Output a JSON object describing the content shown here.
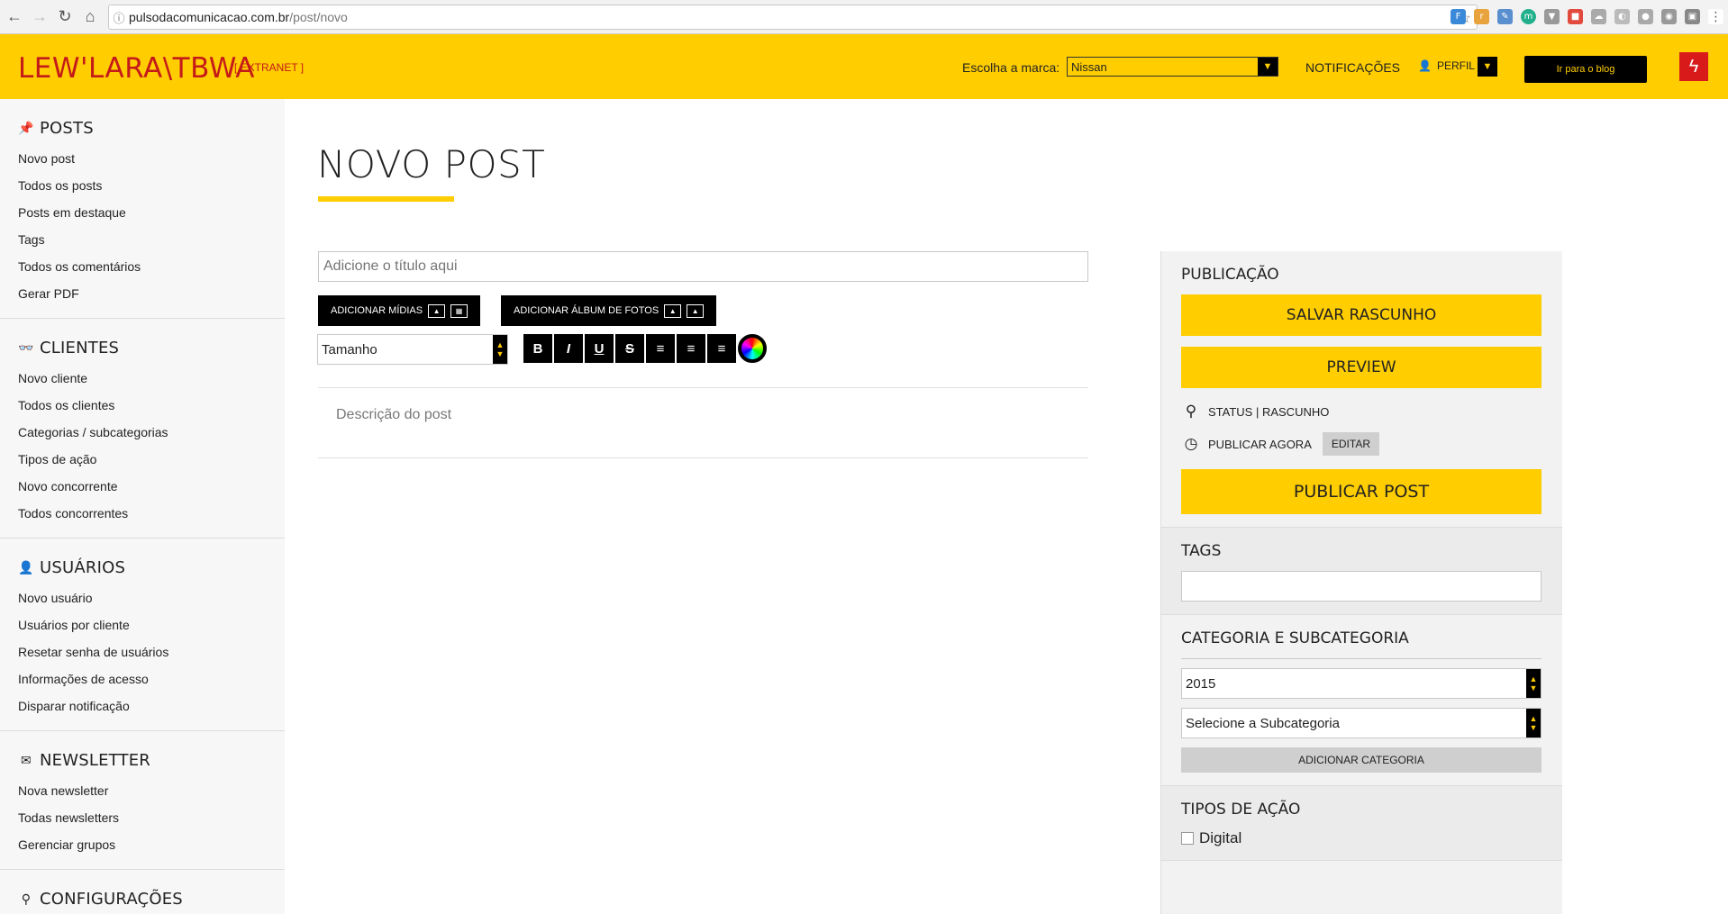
{
  "browser": {
    "url_host": "pulsodacomunicacao.com.br",
    "url_path": "/post/novo"
  },
  "header": {
    "logo": "LEW'LARA\\TBWA",
    "logo_sub": "[ EXTRANET ]",
    "brand_label": "Escolha a marca:",
    "brand_value": "Nissan",
    "notifications": "NOTIFICAÇÕES",
    "profile": "PERFIL",
    "blog_button": "Ir para o blog"
  },
  "sidebar": {
    "sections": [
      {
        "title": "POSTS",
        "icon": "pin-icon",
        "items": [
          "Novo post",
          "Todos os posts",
          "Posts em destaque",
          "Tags",
          "Todos os comentários",
          "Gerar PDF"
        ]
      },
      {
        "title": "CLIENTES",
        "icon": "glasses-icon",
        "items": [
          "Novo cliente",
          "Todos os clientes",
          "Categorias / subcategorias",
          "Tipos de ação",
          "Novo concorrente",
          "Todos concorrentes"
        ]
      },
      {
        "title": "USUÁRIOS",
        "icon": "user-icon",
        "items": [
          "Novo usuário",
          "Usuários por cliente",
          "Resetar senha de usuários",
          "Informações de acesso",
          "Disparar notificação"
        ]
      },
      {
        "title": "NEWSLETTER",
        "icon": "envelope-icon",
        "items": [
          "Nova newsletter",
          "Todas newsletters",
          "Gerenciar grupos"
        ]
      },
      {
        "title": "CONFIGURAÇÕES",
        "icon": "search-icon",
        "items": []
      }
    ]
  },
  "main": {
    "page_title": "NOVO POST",
    "title_placeholder": "Adicione o título aqui",
    "add_media": "ADICIONAR MÍDIAS",
    "add_album": "ADICIONAR ÁLBUM DE FOTOS",
    "size_select": "Tamanho",
    "format_buttons": [
      "B",
      "I",
      "U",
      "S",
      "≡",
      "≡",
      "≡"
    ],
    "description_placeholder": "Descrição do post"
  },
  "publication": {
    "title": "PUBLICAÇÃO",
    "save_draft": "SALVAR RASCUNHO",
    "preview": "PREVIEW",
    "status": "STATUS | RASCUNHO",
    "publish_now": "PUBLICAR AGORA",
    "edit": "EDITAR",
    "publish_post": "PUBLICAR POST"
  },
  "tags": {
    "title": "TAGS"
  },
  "category": {
    "title": "CATEGORIA E SUBCATEGORIA",
    "category_value": "2015",
    "subcategory_value": "Selecione a Subcategoria",
    "add_category": "ADICIONAR CATEGORIA"
  },
  "action_types": {
    "title": "TIPOS DE AÇÃO",
    "options": [
      "Digital"
    ]
  },
  "colors": {
    "brand_yellow": "#ffcd00",
    "logo_red": "#c41a1a"
  }
}
